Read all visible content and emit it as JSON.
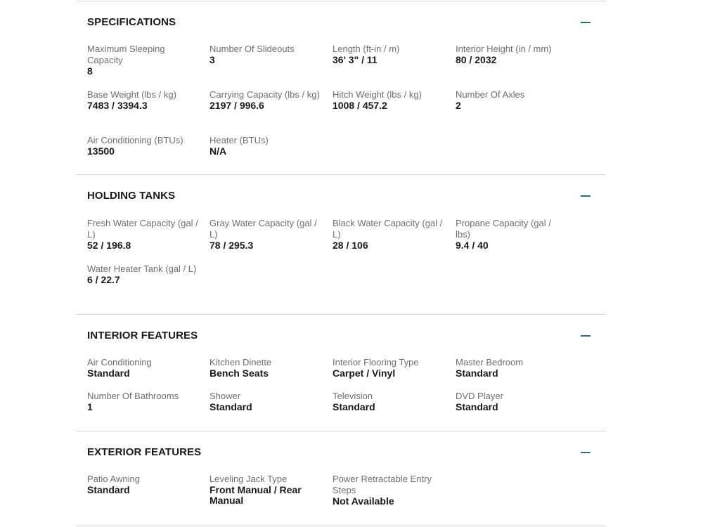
{
  "sections": [
    {
      "title": "SPECIFICATIONS",
      "items": [
        {
          "label": "Maximum Sleeping Capacity",
          "value": "8"
        },
        {
          "label": "Number Of Slideouts",
          "value": "3"
        },
        {
          "label": "Length (ft-in / m)",
          "value": "36' 3\" / 11"
        },
        {
          "label": "Interior Height (in / mm)",
          "value": "80 / 2032"
        },
        {
          "label": "Base Weight (lbs / kg)",
          "value": "7483 / 3394.3"
        },
        {
          "label": "Carrying Capacity (lbs / kg)",
          "value": "2197 / 996.6"
        },
        {
          "label": "Hitch Weight (lbs / kg)",
          "value": "1008 / 457.2"
        },
        {
          "label": "Number Of Axles",
          "value": "2"
        },
        {
          "label": "Air Conditioning (BTUs)",
          "value": "13500"
        },
        {
          "label": "Heater (BTUs)",
          "value": "N/A"
        }
      ]
    },
    {
      "title": "HOLDING TANKS",
      "items": [
        {
          "label": "Fresh Water Capacity (gal / L)",
          "value": "52 / 196.8"
        },
        {
          "label": "Gray Water Capacity (gal / L)",
          "value": "78 / 295.3"
        },
        {
          "label": "Black Water Capacity (gal / L)",
          "value": "28 / 106"
        },
        {
          "label": "Propane Capacity (gal / lbs)",
          "value": "9.4 / 40"
        },
        {
          "label": "Water Heater Tank (gal / L)",
          "value": "6 / 22.7"
        }
      ]
    },
    {
      "title": "INTERIOR FEATURES",
      "items": [
        {
          "label": "Air Conditioning",
          "value": "Standard"
        },
        {
          "label": "Kitchen Dinette",
          "value": "Bench Seats"
        },
        {
          "label": "Interior Flooring Type",
          "value": "Carpet / Vinyl"
        },
        {
          "label": "Master Bedroom",
          "value": "Standard"
        },
        {
          "label": "Number Of Bathrooms",
          "value": "1"
        },
        {
          "label": "Shower",
          "value": "Standard"
        },
        {
          "label": "Television",
          "value": "Standard"
        },
        {
          "label": "DVD Player",
          "value": "Standard"
        }
      ]
    },
    {
      "title": "EXTERIOR FEATURES",
      "items": [
        {
          "label": "Patio Awning",
          "value": "Standard"
        },
        {
          "label": "Leveling Jack Type",
          "value": "Front Manual / Rear Manual"
        },
        {
          "label": "Power Retractable Entry Steps",
          "value": "Not Available"
        }
      ]
    }
  ],
  "icons": {
    "collapse": "minus-icon"
  },
  "colors": {
    "accent": "#2f6f86",
    "label": "#6e6e6e",
    "value": "#1a1a1a",
    "divider": "#d9d9d9"
  }
}
